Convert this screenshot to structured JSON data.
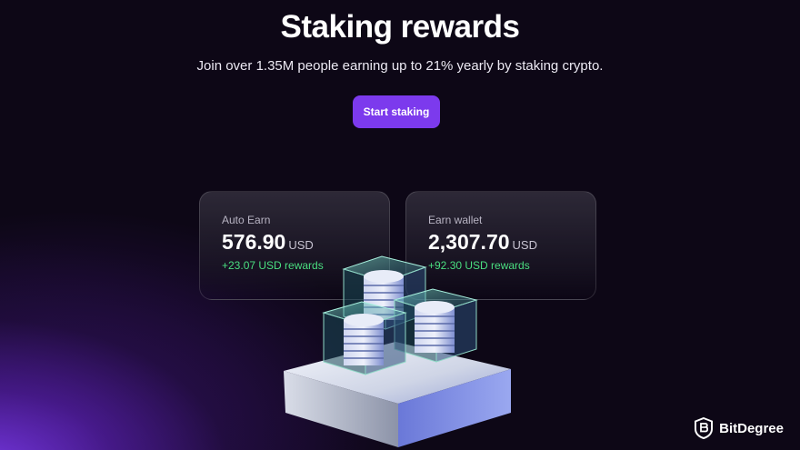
{
  "hero": {
    "title": "Staking rewards",
    "subtitle": "Join over 1.35M people earning up to 21% yearly by staking crypto.",
    "cta_label": "Start staking"
  },
  "cards": [
    {
      "label": "Auto Earn",
      "value": "576.90",
      "unit": "USD",
      "reward": "+23.07 USD rewards"
    },
    {
      "label": "Earn wallet",
      "value": "2,307.70",
      "unit": "USD",
      "reward": "+92.30 USD rewards"
    }
  ],
  "brand": {
    "name": "BitDegree",
    "logo_icon": "bitdegree-shield-logo"
  },
  "colors": {
    "background": "#0d0716",
    "accent": "#7c3aed",
    "reward_green": "#4ade80"
  },
  "illustration": {
    "icon": "coin-stacks-on-platform-icon"
  }
}
